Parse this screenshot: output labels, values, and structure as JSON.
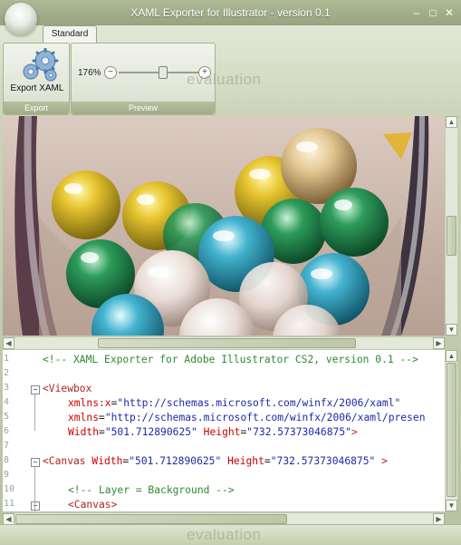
{
  "window": {
    "title": "XAML Exporter for Illustrator - version 0.1",
    "controls": {
      "minimize": "–",
      "maximize": "□",
      "close": "✕"
    }
  },
  "ribbon": {
    "tab_label": "Standard",
    "export_group": {
      "button_label": "Export XAML",
      "group_label": "Export",
      "icon": "gears-icon"
    },
    "preview_group": {
      "zoom_label": "176%",
      "zoom_level_percent": 176,
      "minus": "−",
      "plus": "+",
      "group_label": "Preview"
    },
    "watermark": "evaluation"
  },
  "status": {
    "watermark": "evaluation"
  },
  "colors": {
    "title_bar": "#9eab86",
    "ribbon": "#dde4d1",
    "code_comment": "#2e8b2e",
    "code_tag": "#b22222",
    "code_string": "#1c2aa8"
  },
  "code": {
    "line_numbers": [
      "1",
      "2",
      "3",
      "4",
      "5",
      "6",
      "7",
      "8",
      "9",
      "10",
      "11"
    ],
    "lines": [
      {
        "tokens": [
          {
            "cls": "c-com",
            "text": "<!-- XAML Exporter for Adobe Illustrator CS2, version 0.1 -->"
          }
        ],
        "indent": 0,
        "fold": false
      },
      {
        "tokens": [],
        "indent": 0,
        "fold": false
      },
      {
        "tokens": [
          {
            "cls": "c-tag",
            "text": "<Viewbox"
          }
        ],
        "indent": 0,
        "fold": true
      },
      {
        "tokens": [
          {
            "cls": "c-attr",
            "text": "xmlns:x"
          },
          {
            "cls": "c-txt",
            "text": "="
          },
          {
            "cls": "c-str",
            "text": "\"http://schemas.microsoft.com/winfx/2006/xaml\""
          }
        ],
        "indent": 1,
        "fold": false
      },
      {
        "tokens": [
          {
            "cls": "c-attr",
            "text": "xmlns"
          },
          {
            "cls": "c-txt",
            "text": "="
          },
          {
            "cls": "c-str",
            "text": "\"http://schemas.microsoft.com/winfx/2006/xaml/presen"
          }
        ],
        "indent": 1,
        "fold": false
      },
      {
        "tokens": [
          {
            "cls": "c-attr",
            "text": "Width"
          },
          {
            "cls": "c-txt",
            "text": "="
          },
          {
            "cls": "c-str",
            "text": "\"501.712890625\""
          },
          {
            "cls": "c-txt",
            "text": " "
          },
          {
            "cls": "c-attr",
            "text": "Height"
          },
          {
            "cls": "c-txt",
            "text": "="
          },
          {
            "cls": "c-str",
            "text": "\"732.57373046875\""
          },
          {
            "cls": "c-tag",
            "text": ">"
          }
        ],
        "indent": 1,
        "fold": false
      },
      {
        "tokens": [],
        "indent": 0,
        "fold": false
      },
      {
        "tokens": [
          {
            "cls": "c-tag",
            "text": "<Canvas"
          },
          {
            "cls": "c-txt",
            "text": " "
          },
          {
            "cls": "c-attr",
            "text": "Width"
          },
          {
            "cls": "c-txt",
            "text": "="
          },
          {
            "cls": "c-str",
            "text": "\"501.712890625\""
          },
          {
            "cls": "c-txt",
            "text": " "
          },
          {
            "cls": "c-attr",
            "text": "Height"
          },
          {
            "cls": "c-txt",
            "text": "="
          },
          {
            "cls": "c-str",
            "text": "\"732.57373046875\""
          },
          {
            "cls": "c-txt",
            "text": " "
          },
          {
            "cls": "c-tag",
            "text": ">"
          }
        ],
        "indent": 0,
        "fold": true
      },
      {
        "tokens": [],
        "indent": 0,
        "fold": false
      },
      {
        "tokens": [
          {
            "cls": "c-com",
            "text": "<!-- Layer = Background -->"
          }
        ],
        "indent": 1,
        "fold": false
      },
      {
        "tokens": [
          {
            "cls": "c-tag",
            "text": "<Canvas>"
          }
        ],
        "indent": 1,
        "fold": true
      }
    ]
  }
}
